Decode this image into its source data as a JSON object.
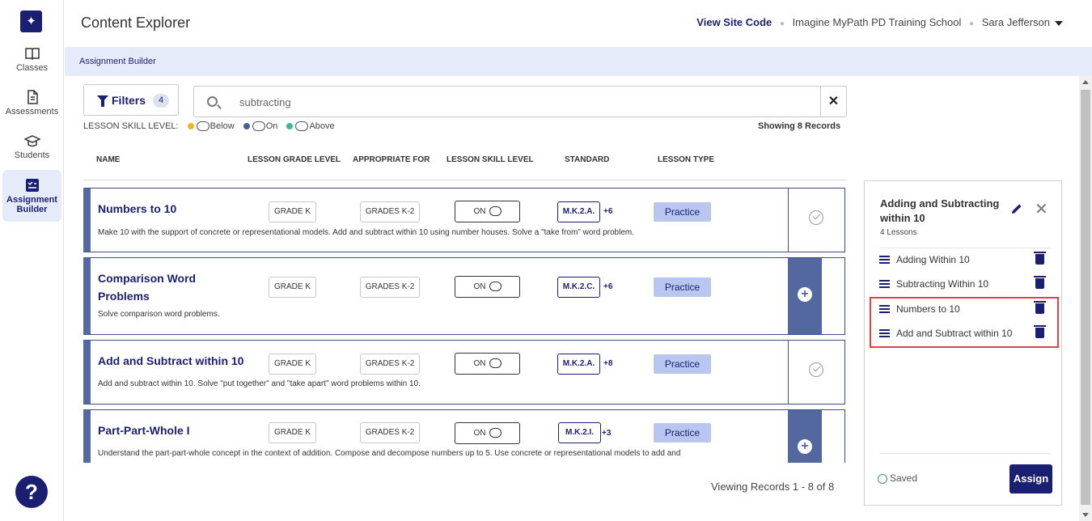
{
  "sidebar": {
    "logo_icon": "sparkle-icon",
    "items": [
      {
        "label": "Classes",
        "icon": "book-icon"
      },
      {
        "label": "Assessments",
        "icon": "document-icon"
      },
      {
        "label": "Students",
        "icon": "graduation-cap-icon"
      },
      {
        "label": "Assignment Builder",
        "icon": "checklist-icon",
        "active": true
      }
    ],
    "help_label": "?"
  },
  "header": {
    "title": "Content Explorer",
    "view_site_code": "View Site Code",
    "school": "Imagine MyPath PD Training School",
    "user": "Sara  Jefferson"
  },
  "breadcrumb": "Assignment Builder",
  "filters": {
    "label": "Filters",
    "count": "4"
  },
  "search": {
    "value": "subtracting"
  },
  "legend": {
    "prefix": "LESSON SKILL LEVEL:",
    "below": "Below",
    "on": "On",
    "above": "Above",
    "colors": {
      "below": "#f2b324",
      "on": "#4b5d9a",
      "above": "#3bb89a"
    }
  },
  "showing": "Showing 8 Records",
  "columns": [
    "NAME",
    "LESSON GRADE LEVEL",
    "APPROPRIATE FOR",
    "LESSON SKILL LEVEL",
    "STANDARD",
    "LESSON TYPE"
  ],
  "lessons": [
    {
      "name": "Numbers to 10",
      "grade": "GRADE K",
      "appropriate": "GRADES K-2",
      "skill": "ON",
      "standard": "M.K.2.A.",
      "more": "+6",
      "type": "Practice",
      "desc": "Make 10 with the support of concrete or representational models. Add and subtract within 10 using number houses. Solve a \"take from\" word problem.",
      "state": "added"
    },
    {
      "name": "Comparison Word Problems",
      "grade": "GRADE K",
      "appropriate": "GRADES K-2",
      "skill": "ON",
      "standard": "M.K.2.C.",
      "more": "+6",
      "type": "Practice",
      "desc": "Solve comparison word problems.",
      "state": "addable"
    },
    {
      "name": "Add and Subtract within 10",
      "grade": "GRADE K",
      "appropriate": "GRADES K-2",
      "skill": "ON",
      "standard": "M.K.2.A.",
      "more": "+8",
      "type": "Practice",
      "desc": "Add and subtract within 10. Solve \"put together\" and \"take apart\" word problems within 10.",
      "state": "added"
    },
    {
      "name": "Part-Part-Whole I",
      "grade": "GRADE K",
      "appropriate": "GRADES K-2",
      "skill": "ON",
      "standard": "M.K.2.I.",
      "more": "+3",
      "type": "Practice",
      "desc": "Understand the part-part-whole concept in the context of addition. Compose and decompose numbers up to 5. Use concrete or representational models to add and",
      "state": "addable"
    }
  ],
  "pager": "Viewing Records 1 - 8 of 8",
  "panel": {
    "title": "Adding and Subtracting within 10",
    "count": "4 Lessons",
    "items": [
      "Adding Within 10",
      "Subtracting Within 10",
      "Numbers to 10",
      "Add and Subtract within 10"
    ],
    "saved": "Saved",
    "assign": "Assign"
  }
}
